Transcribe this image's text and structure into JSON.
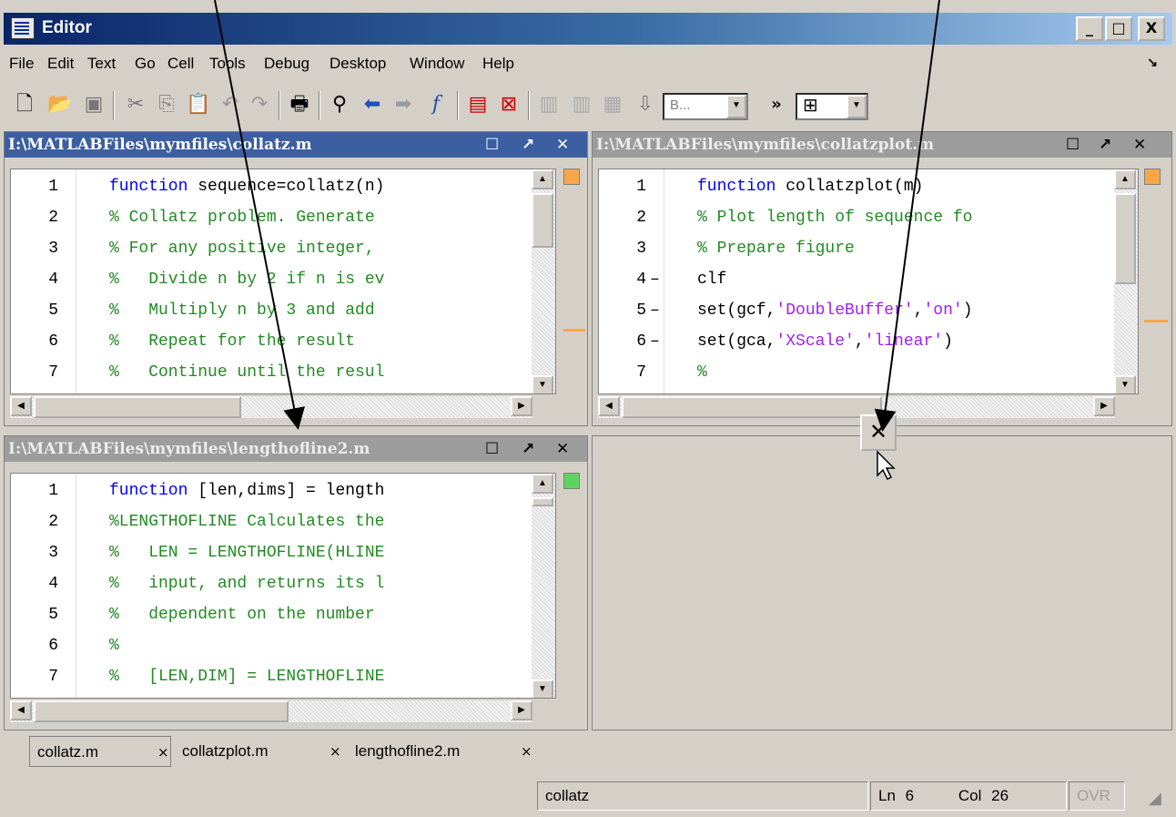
{
  "window": {
    "title": "Editor",
    "controls": [
      "_",
      "□",
      "X"
    ]
  },
  "menu": [
    "File",
    "Edit",
    "Text",
    "Go",
    "Cell",
    "Tools",
    "Debug",
    "Desktop",
    "Window",
    "Help"
  ],
  "toolbar": {
    "stack_combo": "B...",
    "more": "»"
  },
  "panes": [
    {
      "title": "I:\\MATLABFiles\\mymfiles\\collatz.m",
      "lines": [
        {
          "n": "1",
          "dash": "",
          "parts": [
            [
              "kw",
              "function"
            ],
            [
              "tx",
              " sequence=collatz(n)"
            ]
          ]
        },
        {
          "n": "2",
          "dash": "",
          "parts": [
            [
              "cm",
              "% Collatz problem. Generate"
            ]
          ]
        },
        {
          "n": "3",
          "dash": "",
          "parts": [
            [
              "cm",
              "% For any positive integer,"
            ]
          ]
        },
        {
          "n": "4",
          "dash": "",
          "parts": [
            [
              "cm",
              "%   Divide n by 2 if n is ev"
            ]
          ]
        },
        {
          "n": "5",
          "dash": "",
          "parts": [
            [
              "cm",
              "%   Multiply n by 3 and add"
            ]
          ]
        },
        {
          "n": "6",
          "dash": "",
          "parts": [
            [
              "cm",
              "%   Repeat for the result"
            ]
          ]
        },
        {
          "n": "7",
          "dash": "",
          "parts": [
            [
              "cm",
              "%   Continue until the resul"
            ]
          ]
        }
      ]
    },
    {
      "title": "I:\\MATLABFiles\\mymfiles\\collatzplot.m",
      "lines": [
        {
          "n": "1",
          "dash": "",
          "parts": [
            [
              "kw",
              "function"
            ],
            [
              "tx",
              " collatzplot(m)"
            ]
          ]
        },
        {
          "n": "2",
          "dash": "",
          "parts": [
            [
              "cm",
              "% Plot length of sequence fo"
            ]
          ]
        },
        {
          "n": "3",
          "dash": "",
          "parts": [
            [
              "cm",
              "% Prepare figure"
            ]
          ]
        },
        {
          "n": "4",
          "dash": "–",
          "parts": [
            [
              "tx",
              "clf"
            ]
          ]
        },
        {
          "n": "5",
          "dash": "–",
          "parts": [
            [
              "tx",
              "set(gcf,"
            ],
            [
              "str",
              "'DoubleBuffer'"
            ],
            [
              "tx",
              ","
            ],
            [
              "str",
              "'on'"
            ],
            [
              "tx",
              ")"
            ]
          ]
        },
        {
          "n": "6",
          "dash": "–",
          "parts": [
            [
              "tx",
              "set(gca,"
            ],
            [
              "str",
              "'XScale'"
            ],
            [
              "tx",
              ","
            ],
            [
              "str",
              "'linear'"
            ],
            [
              "tx",
              ")"
            ]
          ]
        },
        {
          "n": "7",
          "dash": "",
          "parts": [
            [
              "cm",
              "%"
            ]
          ]
        }
      ]
    },
    {
      "title": "I:\\MATLABFiles\\mymfiles\\lengthofline2.m",
      "lines": [
        {
          "n": "1",
          "dash": "",
          "parts": [
            [
              "kw",
              "function"
            ],
            [
              "tx",
              " [len,dims] = length"
            ]
          ]
        },
        {
          "n": "2",
          "dash": "",
          "parts": [
            [
              "cm",
              "%LENGTHOFLINE Calculates the"
            ]
          ]
        },
        {
          "n": "3",
          "dash": "",
          "parts": [
            [
              "cm",
              "%   LEN = LENGTHOFLINE(HLINE"
            ]
          ]
        },
        {
          "n": "4",
          "dash": "",
          "parts": [
            [
              "cm",
              "%   input, and returns its l"
            ]
          ]
        },
        {
          "n": "5",
          "dash": "",
          "parts": [
            [
              "cm",
              "%   dependent on the number"
            ]
          ]
        },
        {
          "n": "6",
          "dash": "",
          "parts": [
            [
              "cm",
              "%"
            ]
          ]
        },
        {
          "n": "7",
          "dash": "",
          "parts": [
            [
              "cm",
              "%   [LEN,DIM] = LENGTHOFLINE"
            ]
          ]
        }
      ]
    }
  ],
  "tabs": [
    {
      "label": "collatz.m",
      "close": "×"
    },
    {
      "label": "collatzplot.m",
      "close": "×"
    },
    {
      "label": "lengthofline2.m",
      "close": "×"
    }
  ],
  "status": {
    "function": "collatz",
    "ln_label": "Ln",
    "ln": "6",
    "col_label": "Col",
    "col": "26",
    "ovr": "OVR"
  },
  "colors": {
    "active_header": "#3b5fa0",
    "keyword": "#0000ff",
    "comment": "#228b22",
    "string": "#a020f0",
    "marker_orange": "#f7a64a",
    "marker_green": "#5fd35f"
  }
}
